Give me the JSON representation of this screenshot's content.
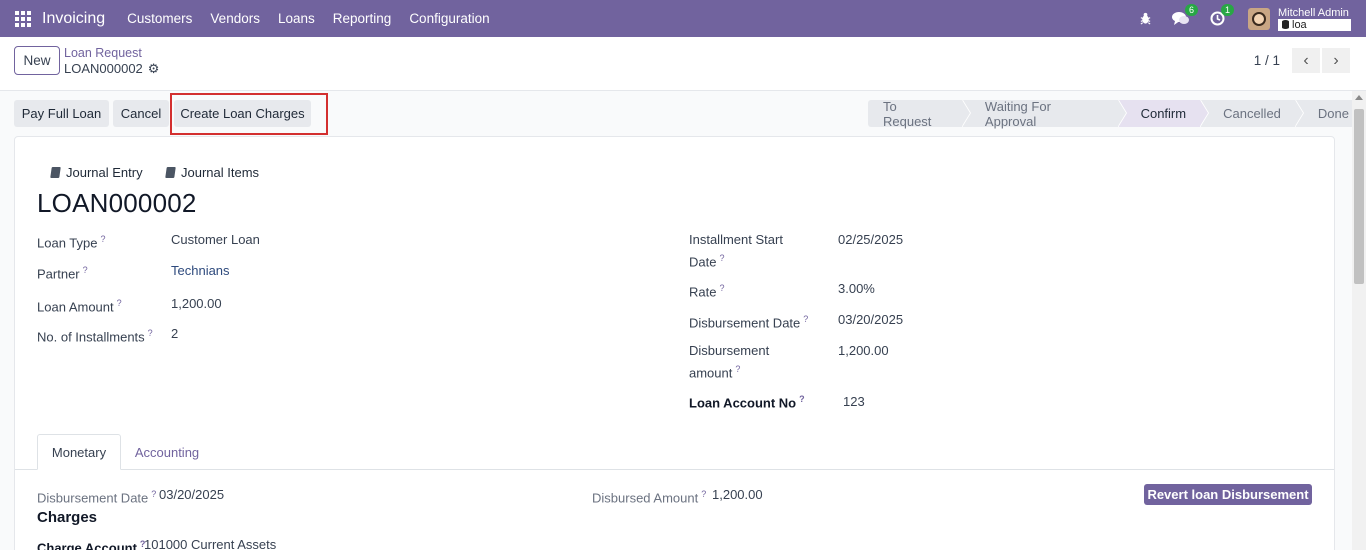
{
  "navbar": {
    "brand": "Invoicing",
    "menu": [
      "Customers",
      "Vendors",
      "Loans",
      "Reporting",
      "Configuration"
    ],
    "messages_count": "6",
    "activities_count": "1",
    "user_name": "Mitchell Admin",
    "database": "loa",
    "bg_color": "#71639e"
  },
  "control_panel": {
    "new_label": "New",
    "breadcrumb_parent": "Loan Request",
    "breadcrumb_current": "LOAN000002",
    "pager": "1 / 1"
  },
  "actions": {
    "pay_full_loan": "Pay Full Loan",
    "cancel": "Cancel",
    "create_loan_charges": "Create Loan Charges"
  },
  "statusbar": {
    "stages": [
      "To Request",
      "Waiting For Approval",
      "Confirm",
      "Cancelled",
      "Done"
    ],
    "active": "Confirm"
  },
  "smart_buttons": {
    "journal_entry": "Journal Entry",
    "journal_items": "Journal Items"
  },
  "record": {
    "title": "LOAN000002",
    "left_fields": [
      {
        "label": "Loan Type",
        "value": "Customer Loan"
      },
      {
        "label": "Partner",
        "value": "Technians"
      },
      {
        "label": "Loan Amount",
        "value": "1,200.00"
      },
      {
        "label": "No. of Installments",
        "value": "2"
      }
    ],
    "right_fields": [
      {
        "label_line1": "Installment Start",
        "label_line2": "Date",
        "value": "02/25/2025"
      },
      {
        "label": "Rate",
        "value": "3.00%"
      },
      {
        "label": "Disbursement Date",
        "value": "03/20/2025"
      },
      {
        "label_line1": "Disbursement",
        "label_line2": "amount",
        "value": "1,200.00"
      },
      {
        "label": "Loan Account No",
        "value": "123"
      }
    ]
  },
  "tabs": {
    "monetary": "Monetary",
    "accounting": "Accounting"
  },
  "monetary": {
    "disbursement_date_label": "Disbursement Date",
    "disbursement_date_value": "03/20/2025",
    "disbursed_amount_label": "Disbursed Amount",
    "disbursed_amount_value": "1,200.00",
    "revert_button": "Revert loan Disbursement",
    "charges_title": "Charges",
    "charge_account_label": "Charge Account",
    "charge_account_value": "101000 Current Assets"
  }
}
